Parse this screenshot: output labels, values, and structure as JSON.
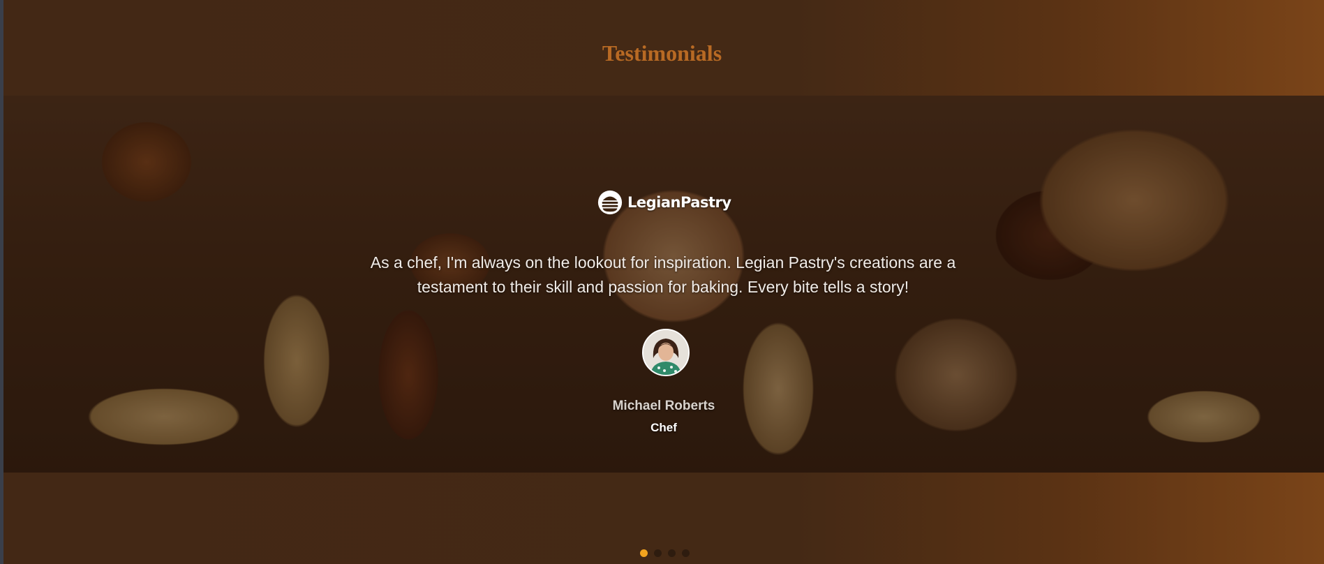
{
  "section": {
    "title": "Testimonials"
  },
  "testimonial": {
    "logo_text": "LegianPastry",
    "quote": "As a chef, I'm always on the lookout for inspiration. Legian Pastry's creations are a testament to their skill and passion for baking. Every bite tells a story!",
    "author_name": "Michael Roberts",
    "author_role": "Chef"
  },
  "pagination": {
    "count": 4,
    "active_index": 0
  },
  "colors": {
    "background": "#432815",
    "title": "#b86a24",
    "active_dot": "#f4a41e",
    "inactive_dot": "#2e1c0f"
  }
}
